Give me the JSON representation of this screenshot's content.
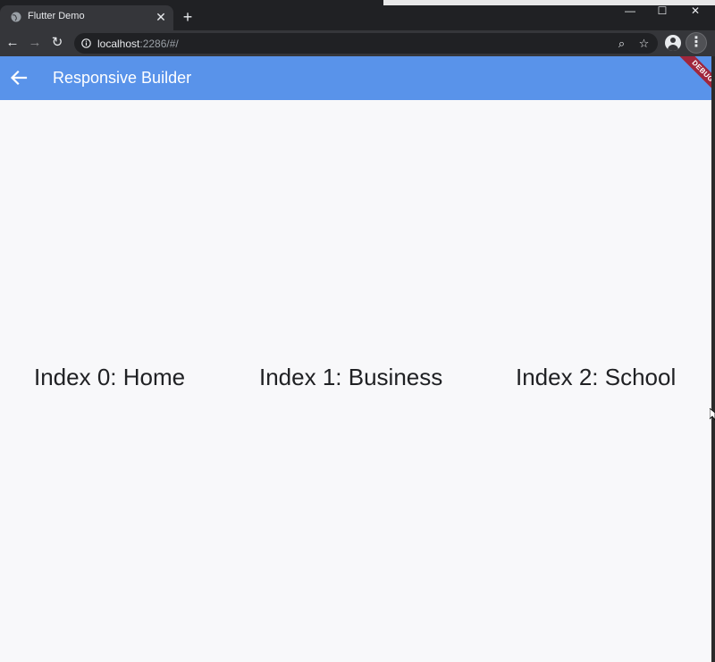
{
  "browser": {
    "tab_title": "Flutter Demo",
    "tab_close": "✕",
    "new_tab": "+",
    "window_controls": {
      "minimize": "—",
      "maximize": "☐",
      "close": "✕"
    },
    "nav": {
      "back": "←",
      "forward": "→",
      "reload": "↻"
    },
    "url_host": "localhost",
    "url_rest": ":2286/#/",
    "zoom_icon": "⌕",
    "bookmark_icon": "☆",
    "menu_icon": "⋮"
  },
  "app": {
    "title": "Responsive Builder",
    "appbar_color": "#5993ea",
    "debug_banner": "DEBUG",
    "items": [
      {
        "label": "Index 0: Home"
      },
      {
        "label": "Index 1: Business"
      },
      {
        "label": "Index 2: School"
      }
    ]
  }
}
